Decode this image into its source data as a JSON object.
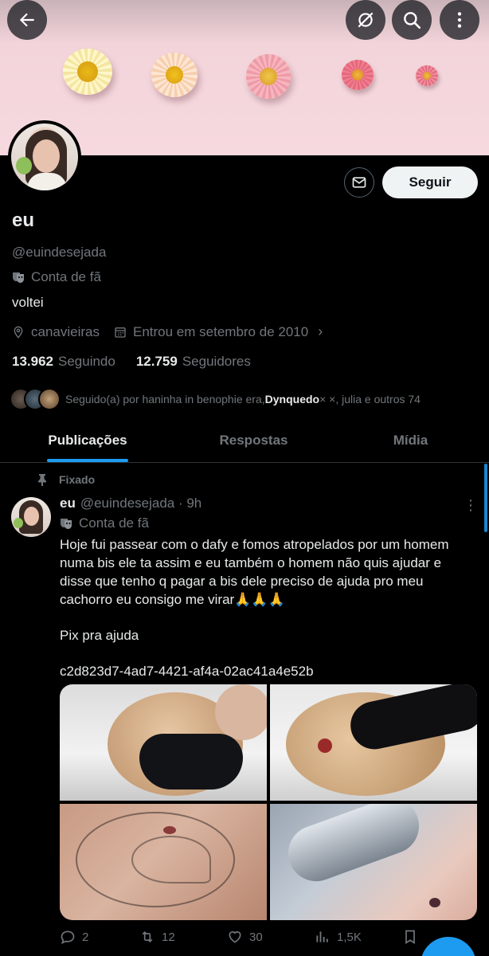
{
  "profile": {
    "name": "eu",
    "handle": "@euindesejada",
    "fan_label": "Conta de fã",
    "bio": "voltei",
    "location": "canavieiras",
    "joined": "Entrou em setembro de 2010",
    "following_count": "13.962",
    "following_label": "Seguindo",
    "followers_count": "12.759",
    "followers_label": "Seguidores",
    "followed_by_prefix": "Seguido(a) por haninha in benophie era, ",
    "followed_by_bold": "Dynquedo",
    "followed_by_suffix": " × ×, julia e outros 74",
    "follow_button": "Seguir"
  },
  "tabs": [
    "Publicações",
    "Respostas",
    "Mídia"
  ],
  "post": {
    "pinned_label": "Fixado",
    "author": "eu",
    "handle_time": "@euindesejada · 9h",
    "fan_label": "Conta de fã",
    "text_lines": [
      "Hoje fui passear com o dafy e fomos atropelados por um homem numa bis ele ta assim e eu também o homem não quis ajudar e disse que tenho q pagar a bis dele preciso de ajuda pro meu cachorro eu consigo me virar🙏🙏🙏",
      "Pix pra ajuda",
      "c2d823d7-4ad7-4421-af4a-02ac41a4e52b"
    ],
    "replies": "2",
    "reposts": "12",
    "likes": "30",
    "views": "1,5K"
  },
  "icons": {
    "back": "arrow-left-icon",
    "grok": "grok-icon",
    "search": "search-icon",
    "more": "more-vertical-icon",
    "mail": "mail-icon",
    "location": "location-pin-icon",
    "calendar": "calendar-icon",
    "pin": "pin-icon"
  },
  "colors": {
    "accent": "#1d9bf0",
    "muted": "#71767b",
    "text": "#e7e9ea",
    "background": "#000000"
  }
}
